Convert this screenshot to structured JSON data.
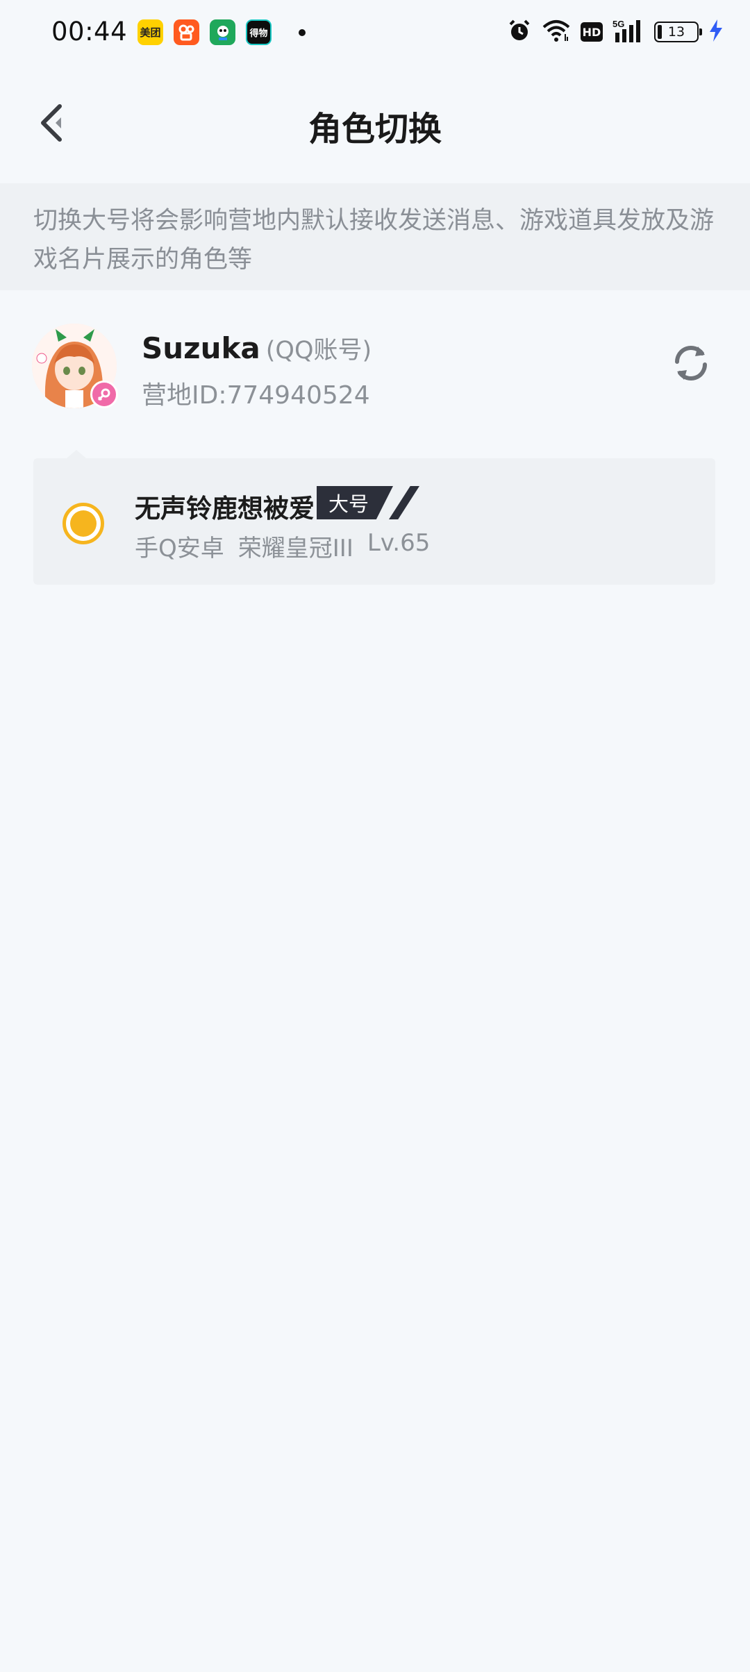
{
  "status_bar": {
    "time": "00:44",
    "app_icons": [
      {
        "name": "meituan-icon",
        "text": "美团"
      },
      {
        "name": "kuaishou-icon",
        "text": ""
      },
      {
        "name": "green-app-icon",
        "text": ""
      },
      {
        "name": "dewu-icon",
        "text": "得物"
      }
    ],
    "network": "5G",
    "hd": "HD",
    "battery_level": "13"
  },
  "header": {
    "title": "角色切换"
  },
  "notice": {
    "text": "切换大号将会影响营地内默认接收发送消息、游戏道具发放及游戏名片展示的角色等"
  },
  "account": {
    "name": "Suzuka",
    "type": "(QQ账号)",
    "camp_id": "营地ID:774940524"
  },
  "roles": [
    {
      "name": "无声铃鹿想被爱",
      "badge": "大号",
      "platform": "手Q安卓",
      "rank": "荣耀皇冠III",
      "level": "Lv.65",
      "selected": true
    }
  ],
  "colors": {
    "accent": "#f6b51e",
    "badge_bg": "#2c2f3a",
    "page_bg": "#f5f8fb",
    "card_bg": "#eef1f4"
  }
}
